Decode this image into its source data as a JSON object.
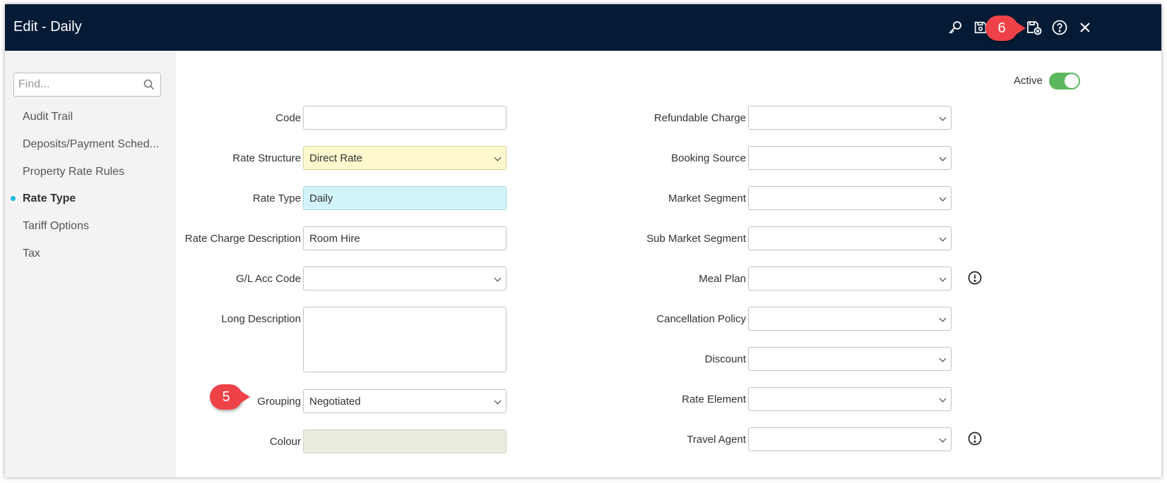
{
  "window": {
    "title": "Edit - Daily"
  },
  "toolbar": {
    "icons": [
      "key-icon",
      "save-icon",
      "save-exit-icon",
      "help-icon",
      "close-icon"
    ]
  },
  "sidebar": {
    "find_placeholder": "Find...",
    "items": [
      {
        "label": "Audit Trail"
      },
      {
        "label": "Deposits/Payment Sched..."
      },
      {
        "label": "Property Rate Rules"
      },
      {
        "label": "Rate Type",
        "active": true
      },
      {
        "label": "Tariff Options"
      },
      {
        "label": "Tax"
      }
    ]
  },
  "status": {
    "active_label": "Active",
    "active_on": true
  },
  "form_left": {
    "code": {
      "label": "Code",
      "value": ""
    },
    "rate_structure": {
      "label": "Rate Structure",
      "value": "Direct Rate"
    },
    "rate_type": {
      "label": "Rate Type",
      "value": "Daily"
    },
    "rate_charge_description": {
      "label": "Rate Charge Description",
      "value": "Room Hire"
    },
    "gl_acc_code": {
      "label": "G/L Acc Code",
      "value": ""
    },
    "long_description": {
      "label": "Long Description",
      "value": ""
    },
    "grouping": {
      "label": "Grouping",
      "value": "Negotiated"
    },
    "colour": {
      "label": "Colour",
      "value": ""
    }
  },
  "form_right": {
    "refundable_charge": {
      "label": "Refundable Charge",
      "value": ""
    },
    "booking_source": {
      "label": "Booking Source",
      "value": ""
    },
    "market_segment": {
      "label": "Market Segment",
      "value": ""
    },
    "sub_market_segment": {
      "label": "Sub Market Segment",
      "value": ""
    },
    "meal_plan": {
      "label": "Meal Plan",
      "value": ""
    },
    "cancellation_policy": {
      "label": "Cancellation Policy",
      "value": ""
    },
    "discount": {
      "label": "Discount",
      "value": ""
    },
    "rate_element": {
      "label": "Rate Element",
      "value": ""
    },
    "travel_agent": {
      "label": "Travel Agent",
      "value": ""
    }
  },
  "callouts": {
    "step5": "5",
    "step6": "6"
  },
  "colors": {
    "titlebar": "#041b36",
    "accent": "#19b8d6",
    "toggle_on": "#5cb85c",
    "callout": "#ee4248"
  }
}
